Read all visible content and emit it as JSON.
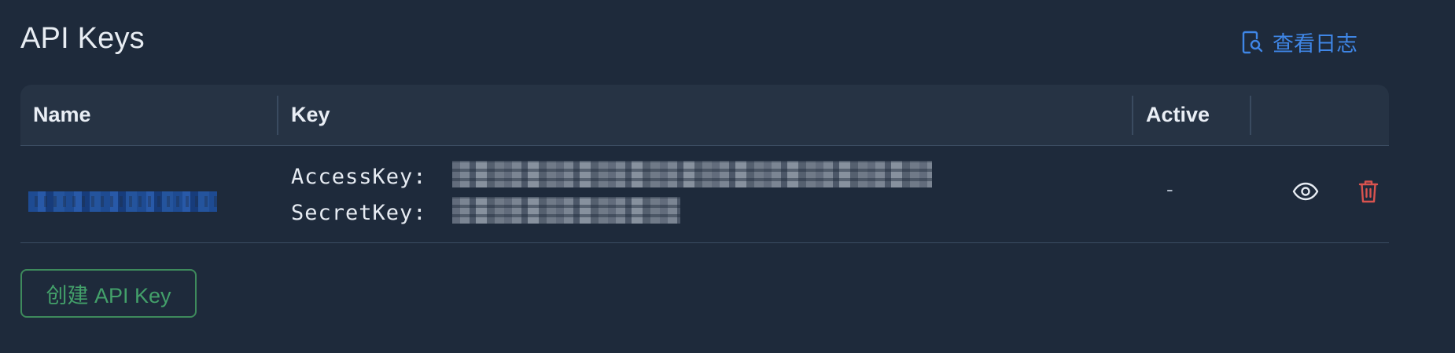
{
  "header": {
    "title": "API Keys",
    "logs_link_label": "查看日志"
  },
  "table": {
    "columns": [
      "Name",
      "Key",
      "Active",
      ""
    ],
    "rows": [
      {
        "name": "",
        "access_key_label": "AccessKey:",
        "secret_key_label": "SecretKey:",
        "active": "-"
      }
    ]
  },
  "actions": {
    "create_label": "创建 API Key"
  },
  "colors": {
    "background": "#1e2a3b",
    "accent_blue": "#3f86e6",
    "accent_green": "#43a06a",
    "danger_red": "#d9534f"
  },
  "icons": {
    "logs": "document-search-icon",
    "view": "eye-icon",
    "delete": "trash-icon"
  }
}
